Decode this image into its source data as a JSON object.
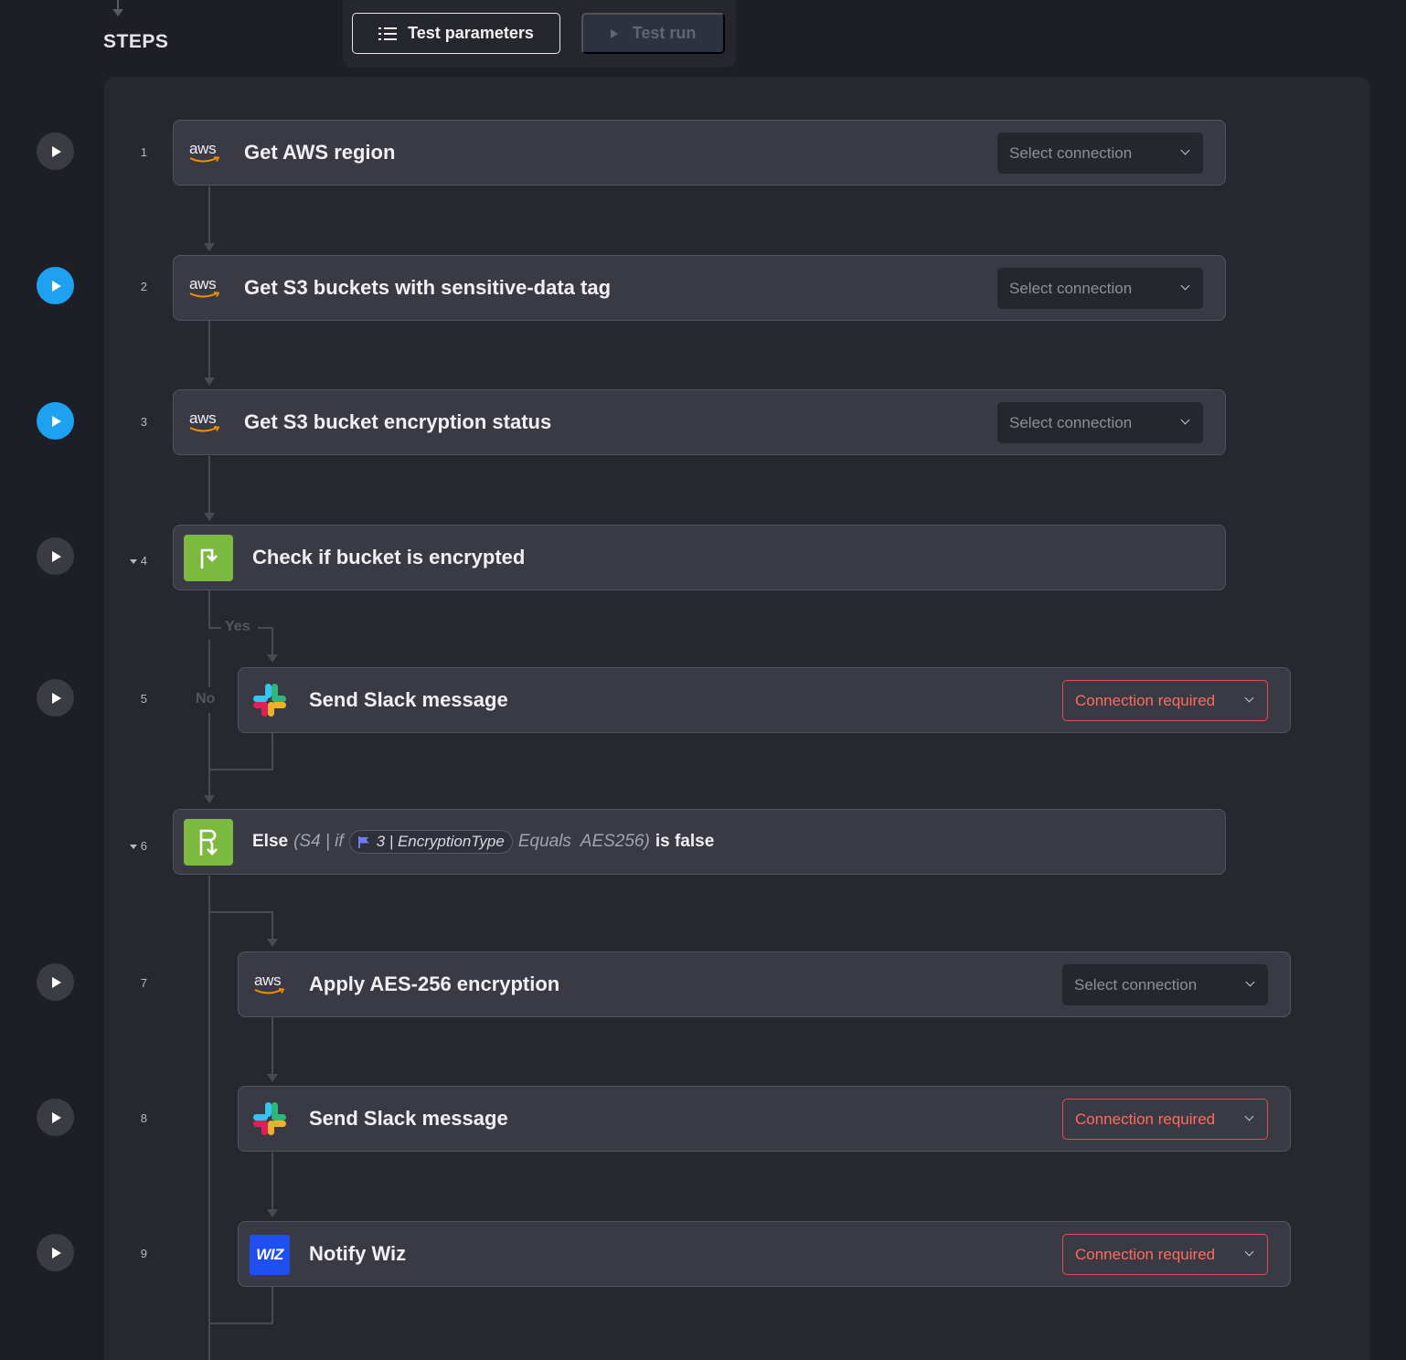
{
  "header": {
    "steps_title": "STEPS",
    "test_parameters_label": "Test parameters",
    "test_run_label": "Test run"
  },
  "colors": {
    "background": "#1e1e26",
    "panel": "#272730",
    "card": "#3a3a44",
    "active_run": "#1ea1f1",
    "condition_icon": "#7cba3f",
    "required_border": "#e5484d",
    "wiz": "#1f4ff0"
  },
  "branch_labels": {
    "yes": "Yes",
    "no": "No"
  },
  "steps": [
    {
      "number": "1",
      "title": "Get AWS region",
      "icon": "aws-icon",
      "aws_text": "aws",
      "connection": "Select connection",
      "run_active": false
    },
    {
      "number": "2",
      "title": "Get S3 buckets with sensitive-data tag",
      "icon": "aws-icon",
      "aws_text": "aws",
      "connection": "Select connection",
      "run_active": true
    },
    {
      "number": "3",
      "title": "Get S3 bucket encryption status",
      "icon": "aws-icon",
      "aws_text": "aws",
      "connection": "Select connection",
      "run_active": true
    },
    {
      "number": "4",
      "title": "Check if bucket is encrypted",
      "icon": "condition-icon",
      "run_active": false,
      "collapsible": true
    },
    {
      "number": "5",
      "title": "Send Slack message",
      "icon": "slack-icon",
      "connection": "Connection required",
      "run_active": false
    },
    {
      "number": "6",
      "icon": "else-icon",
      "run_active": false,
      "collapsible": true,
      "else": {
        "keyword": "Else",
        "prefix": "(S4 | if",
        "variable": "3 | EncryptionType",
        "condition": "Equals  AES256)",
        "suffix": "is false"
      }
    },
    {
      "number": "7",
      "title": "Apply AES-256 encryption",
      "icon": "aws-icon",
      "aws_text": "aws",
      "connection": "Select connection",
      "run_active": false
    },
    {
      "number": "8",
      "title": "Send Slack message",
      "icon": "slack-icon",
      "connection": "Connection required",
      "run_active": false
    },
    {
      "number": "9",
      "title": "Notify Wiz",
      "icon": "wiz-icon",
      "wiz_text": "WIZ",
      "connection": "Connection required",
      "run_active": false
    }
  ]
}
